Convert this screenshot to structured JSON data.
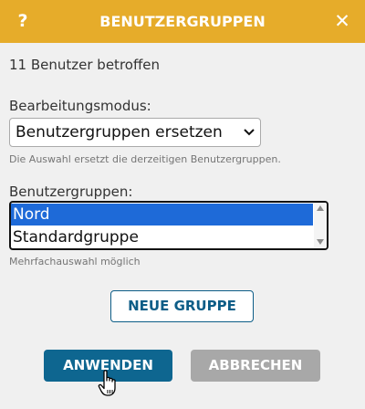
{
  "titlebar": {
    "help_icon": "?",
    "title": "BENUTZERGRUPPEN",
    "close_icon": "✕",
    "background_color": "#e6ac2a"
  },
  "affected_text": "11 Benutzer betroffen",
  "edit_mode": {
    "label": "Bearbeitungsmodus:",
    "selected_value": "Benutzergruppen ersetzen",
    "hint": "Die Auswahl ersetzt die derzeitigen Benutzergruppen."
  },
  "user_groups": {
    "label": "Benutzergruppen:",
    "options": [
      {
        "label": "Nord",
        "selected": true
      },
      {
        "label": "Standardgruppe",
        "selected": false
      }
    ],
    "hint": "Mehrfachauswahl möglich",
    "selection_color": "#1e6ad8"
  },
  "buttons": {
    "new_group": "NEUE GRUPPE",
    "apply": "ANWENDEN",
    "cancel": "ABBRECHEN"
  },
  "icons": {
    "help": "question-mark-icon",
    "close": "close-icon",
    "dropdown": "chevron-down-icon",
    "cursor": "hand-pointer-icon"
  }
}
